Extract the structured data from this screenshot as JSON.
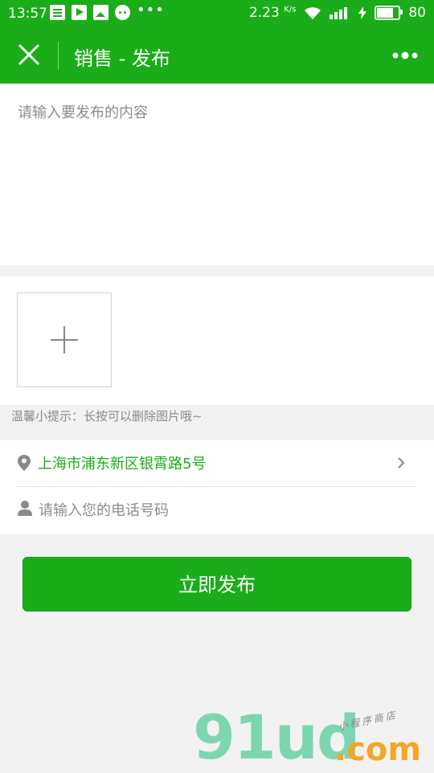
{
  "status_bar": {
    "time": "13:57",
    "overflow": "•••",
    "speed": "2.23",
    "speed_unit": "K/s",
    "battery": "80",
    "battery_fraction": 0.8
  },
  "nav": {
    "title": "销售 - 发布",
    "close_icon": "close-icon",
    "more_icon": "more-icon"
  },
  "form": {
    "content_placeholder": "请输入要发布的内容",
    "tip": "温馨小提示：长按可以删除图片哦~",
    "location": "上海市浦东新区银霄路5号",
    "phone_placeholder": "请输入您的电话号码",
    "publish_label": "立即发布"
  },
  "watermark": {
    "main": "91ud",
    "sub": "小程序商店",
    "com": ".com"
  },
  "colors": {
    "brand": "#1aad19",
    "background": "#f2f2f2",
    "placeholder": "#8c8c8c"
  }
}
